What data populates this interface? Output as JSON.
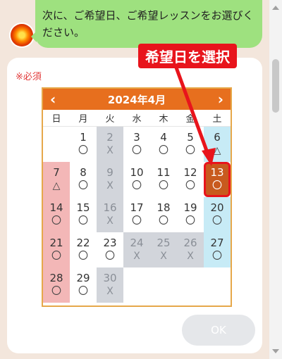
{
  "chat": {
    "message": "次に、ご希望日、ご希望レッスンをお選びください。"
  },
  "form": {
    "required_label": "※必須"
  },
  "calendar": {
    "title": "2024年4月",
    "prev_icon": "chevron-left-icon",
    "next_icon": "chevron-right-icon",
    "prev_glyph": "‹",
    "next_glyph": "›",
    "weekdays": [
      "日",
      "月",
      "火",
      "水",
      "木",
      "金",
      "土"
    ],
    "days": [
      {
        "day": "",
        "mark": "",
        "status": "empty"
      },
      {
        "day": "1",
        "mark": "〇",
        "status": "open"
      },
      {
        "day": "2",
        "mark": "X",
        "status": "closed"
      },
      {
        "day": "3",
        "mark": "〇",
        "status": "open"
      },
      {
        "day": "4",
        "mark": "〇",
        "status": "open"
      },
      {
        "day": "5",
        "mark": "〇",
        "status": "open"
      },
      {
        "day": "6",
        "mark": "△",
        "status": "sat"
      },
      {
        "day": "7",
        "mark": "△",
        "status": "sun"
      },
      {
        "day": "8",
        "mark": "〇",
        "status": "open"
      },
      {
        "day": "9",
        "mark": "X",
        "status": "closed"
      },
      {
        "day": "10",
        "mark": "〇",
        "status": "open"
      },
      {
        "day": "11",
        "mark": "〇",
        "status": "open"
      },
      {
        "day": "12",
        "mark": "〇",
        "status": "open"
      },
      {
        "day": "13",
        "mark": "〇",
        "status": "selected"
      },
      {
        "day": "14",
        "mark": "〇",
        "status": "sun"
      },
      {
        "day": "15",
        "mark": "〇",
        "status": "open"
      },
      {
        "day": "16",
        "mark": "X",
        "status": "closed"
      },
      {
        "day": "17",
        "mark": "〇",
        "status": "open"
      },
      {
        "day": "18",
        "mark": "〇",
        "status": "open"
      },
      {
        "day": "19",
        "mark": "〇",
        "status": "open"
      },
      {
        "day": "20",
        "mark": "〇",
        "status": "sat"
      },
      {
        "day": "21",
        "mark": "〇",
        "status": "sun"
      },
      {
        "day": "22",
        "mark": "〇",
        "status": "open"
      },
      {
        "day": "23",
        "mark": "〇",
        "status": "open"
      },
      {
        "day": "24",
        "mark": "X",
        "status": "closed"
      },
      {
        "day": "25",
        "mark": "X",
        "status": "closed"
      },
      {
        "day": "26",
        "mark": "X",
        "status": "closed"
      },
      {
        "day": "27",
        "mark": "〇",
        "status": "sat"
      },
      {
        "day": "28",
        "mark": "〇",
        "status": "sun"
      },
      {
        "day": "29",
        "mark": "〇",
        "status": "open"
      },
      {
        "day": "30",
        "mark": "X",
        "status": "closed"
      }
    ]
  },
  "buttons": {
    "ok_label": "OK"
  },
  "annotation": {
    "label": "希望日を選択"
  },
  "colors": {
    "bubble": "#9ee17f",
    "header": "#e76f1e",
    "closed": "#d2d5db",
    "sunday": "#f3b7b7",
    "saturday": "#c7ebf6",
    "selected": "#c85a1e",
    "annotation": "#e8141c"
  }
}
